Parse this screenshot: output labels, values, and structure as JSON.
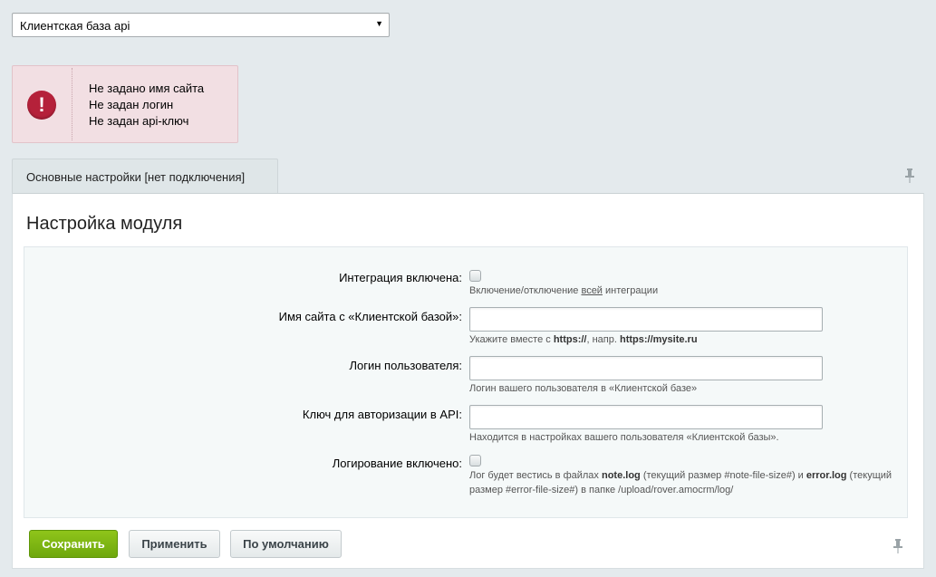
{
  "module_select": {
    "value": "Клиентская база api"
  },
  "errors": [
    "Не задано имя сайта",
    "Не задан логин",
    "Не задан api-ключ"
  ],
  "tabs": [
    {
      "label": "Основные настройки [нет подключения]"
    }
  ],
  "panel": {
    "title": "Настройка модуля"
  },
  "form": {
    "integration": {
      "label": "Интеграция включена:",
      "checked": false,
      "hint_pre": "Включение/отключение ",
      "hint_underline": "всей",
      "hint_post": " интеграции"
    },
    "site_name": {
      "label": "Имя сайта с «Клиентской базой»:",
      "value": "",
      "hint_pre": "Укажите вместе с ",
      "hint_b1": "https://",
      "hint_mid": ", напр. ",
      "hint_b2": "https://mysite.ru"
    },
    "login": {
      "label": "Логин пользователя:",
      "value": "",
      "hint": "Логин вашего пользователя в «Клиентской базе»"
    },
    "api_key": {
      "label": "Ключ для авторизации в API:",
      "value": "",
      "hint": "Находится в настройках вашего пользователя «Клиентской базы»."
    },
    "logging": {
      "label": "Логирование включено:",
      "checked": false,
      "hint_1": "Лог будет вестись в файлах ",
      "hint_b1": "note.log",
      "hint_2": " (текущий размер #note-file-size#) и ",
      "hint_b2": "error.log",
      "hint_3": " (текущий",
      "hint_4": "размер #error-file-size#) в папке /upload/rover.amocrm/log/"
    }
  },
  "buttons": {
    "save": "Сохранить",
    "apply": "Применить",
    "default": "По умолчанию"
  },
  "icons": {
    "error": "exclamation-circle-icon",
    "pin": "pin-icon",
    "dropdown": "triangle-down-icon"
  },
  "colors": {
    "error_bg": "#f2dfe3",
    "error_icon": "#b5213a",
    "save_button": "#7bb614",
    "page_bg": "#e4eaed"
  }
}
